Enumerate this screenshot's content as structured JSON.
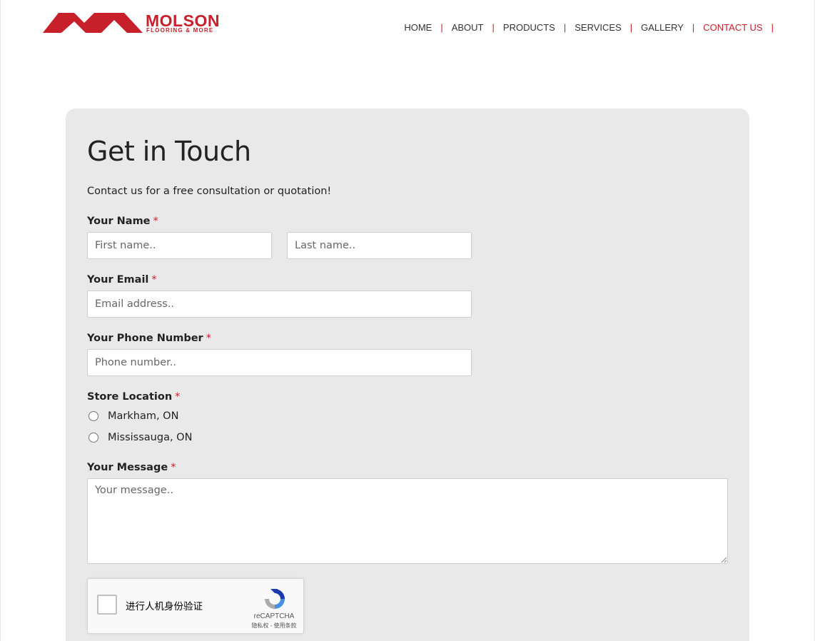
{
  "brand": {
    "name": "MOLSON",
    "tagline": "FLOORING & MORE",
    "accent_color": "#c8202a"
  },
  "nav": {
    "items": [
      {
        "label": "HOME"
      },
      {
        "label": "ABOUT"
      },
      {
        "label": "PRODUCTS"
      },
      {
        "label": "SERVICES"
      },
      {
        "label": "GALLERY"
      },
      {
        "label": "CONTACT US",
        "active": true
      }
    ],
    "separator": "|"
  },
  "form": {
    "title": "Get in Touch",
    "subtitle": "Contact us for a free consultation or quotation!",
    "required_mark": "*",
    "name": {
      "label": "Your Name",
      "first_placeholder": "First name..",
      "last_placeholder": "Last name.."
    },
    "email": {
      "label": "Your Email",
      "placeholder": "Email address.."
    },
    "phone": {
      "label": "Your Phone Number",
      "placeholder": "Phone number.."
    },
    "store": {
      "label": "Store Location",
      "options": [
        "Markham, ON",
        "Mississauga, ON"
      ]
    },
    "message": {
      "label": "Your Message",
      "placeholder": "Your message.."
    }
  },
  "captcha": {
    "prompt": "进行人机身份验证",
    "brand": "reCAPTCHA",
    "links": "隐私权 - 使用条款"
  }
}
